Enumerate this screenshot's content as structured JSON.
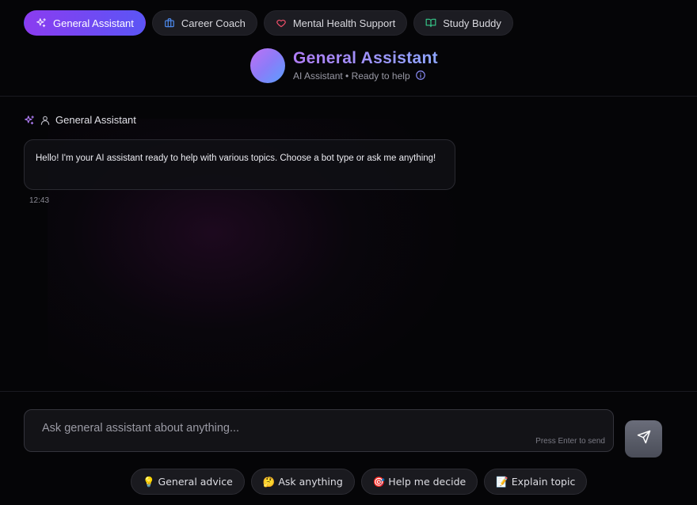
{
  "tabs": [
    {
      "label": "General Assistant",
      "icon": "sparkles-icon",
      "active": true,
      "color": "#ffffff"
    },
    {
      "label": "Career Coach",
      "icon": "briefcase-icon",
      "active": false,
      "color": "#4f8ff7"
    },
    {
      "label": "Mental Health Support",
      "icon": "heart-icon",
      "active": false,
      "color": "#f0506a"
    },
    {
      "label": "Study Buddy",
      "icon": "book-icon",
      "active": false,
      "color": "#36c98a"
    }
  ],
  "header": {
    "title": "General Assistant",
    "subtitle": "AI Assistant • Ready to help",
    "info_icon": "info-icon"
  },
  "message": {
    "sender": "General Assistant",
    "text": "Hello! I'm your AI assistant ready to help with various topics. Choose a bot type or ask me anything!",
    "time": "12:43"
  },
  "composer": {
    "placeholder": "Ask general assistant about anything...",
    "value": "",
    "hint": "Press Enter to send",
    "send_icon": "send-icon"
  },
  "quick_actions": [
    "💡 General advice",
    "🤔 Ask anything",
    "🎯 Help me decide",
    "📝 Explain topic"
  ],
  "colors": {
    "accent_start": "#8b3cf0",
    "accent_end": "#5b55f5",
    "background": "#050507"
  }
}
